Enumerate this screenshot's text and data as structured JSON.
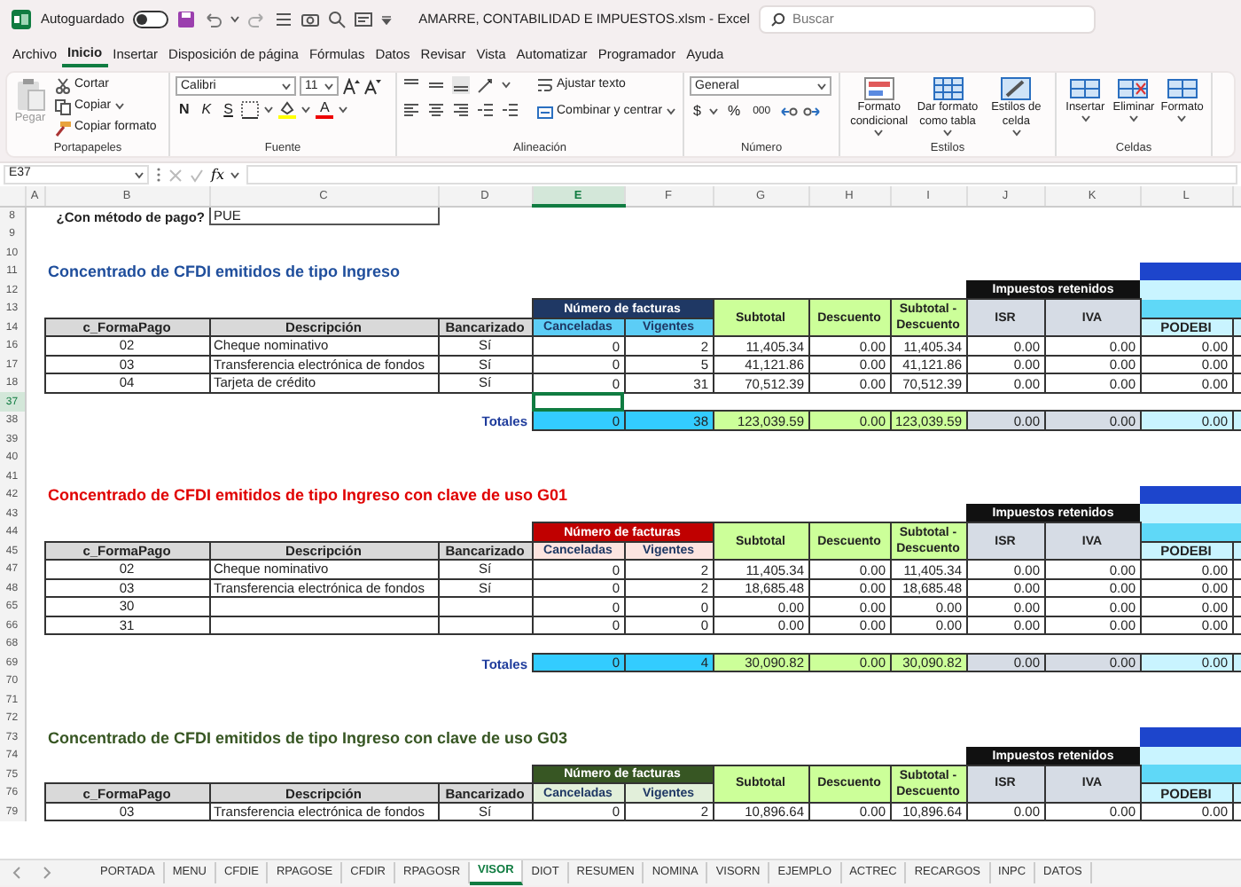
{
  "title_bar": {
    "autosave_label": "Autoguardado",
    "autosave_on": false,
    "title": "AMARRE, CONTABILIDAD E IMPUESTOS.xlsm  -  Excel",
    "search_placeholder": "Buscar"
  },
  "menu_tabs": [
    {
      "label": "Archivo",
      "selected": false
    },
    {
      "label": "Inicio",
      "selected": true
    },
    {
      "label": "Insertar",
      "selected": false
    },
    {
      "label": "Disposición de página",
      "selected": false
    },
    {
      "label": "Fórmulas",
      "selected": false
    },
    {
      "label": "Datos",
      "selected": false
    },
    {
      "label": "Revisar",
      "selected": false
    },
    {
      "label": "Vista",
      "selected": false
    },
    {
      "label": "Automatizar",
      "selected": false
    },
    {
      "label": "Programador",
      "selected": false
    },
    {
      "label": "Ayuda",
      "selected": false
    }
  ],
  "ribbon": {
    "groups": [
      {
        "label": "Portapapeles",
        "items": [
          {
            "label": "Pegar",
            "disabled": true
          },
          {
            "label": "Cortar",
            "disabled": false
          },
          {
            "label": "Copiar",
            "disabled": false
          },
          {
            "label": "Copiar formato",
            "disabled": false
          }
        ]
      },
      {
        "label": "Fuente",
        "font": "Calibri",
        "size": "11",
        "glyphs": [
          "N",
          "K",
          "S",
          "A"
        ]
      },
      {
        "label": "Alineación",
        "items": [
          {
            "label": "Ajustar texto"
          },
          {
            "label": "Combinar y centrar"
          }
        ]
      },
      {
        "label": "Número",
        "format": "General",
        "glyphs": [
          "$",
          "%",
          "000"
        ]
      },
      {
        "label": "Estilos",
        "items": [
          {
            "label": "Formato condicional"
          },
          {
            "label": "Dar formato como tabla"
          },
          {
            "label": "Estilos de celda"
          }
        ]
      },
      {
        "label": "Celdas",
        "items": [
          {
            "label": "Insertar"
          },
          {
            "label": "Eliminar"
          },
          {
            "label": "Formato"
          }
        ]
      }
    ]
  },
  "formula_bar": {
    "name_box": "E37",
    "function_label": "fx"
  },
  "columns": [
    {
      "label": "A",
      "selected": false
    },
    {
      "label": "B",
      "selected": false
    },
    {
      "label": "C",
      "selected": false
    },
    {
      "label": "D",
      "selected": false
    },
    {
      "label": "E",
      "selected": true
    },
    {
      "label": "F",
      "selected": false
    },
    {
      "label": "G",
      "selected": false
    },
    {
      "label": "H",
      "selected": false
    },
    {
      "label": "I",
      "selected": false
    },
    {
      "label": "J",
      "selected": false
    },
    {
      "label": "K",
      "selected": false
    },
    {
      "label": "L",
      "selected": false
    }
  ],
  "rows": [
    {
      "kind": "method",
      "number": "8",
      "question": "¿Con método de pago?",
      "value": "PUE"
    },
    {
      "kind": "blank",
      "number": "9",
      "selected": false
    },
    {
      "kind": "blank",
      "number": "10",
      "selected": false
    },
    {
      "kind": "title",
      "number": "11",
      "text": "Concentrado de CFDI emitidos de tipo Ingreso",
      "color": "#1f4e9c"
    },
    {
      "kind": "retenidos",
      "number": "12",
      "label": "Impuestos retenidos"
    },
    {
      "kind": "header",
      "numbers": [
        "13",
        "14"
      ],
      "group": "Número de facturas",
      "color": "#1f3864",
      "subheaders": [
        {
          "label": "Canceladas",
          "color": "#5ccdf6"
        },
        {
          "label": "Vigentes",
          "color": "#5ccdf6"
        }
      ],
      "labels": [
        "c_FormaPago",
        "Descripción",
        "Bancarizado",
        "Subtotal",
        "Descuento",
        "Subtotal - Descuento",
        "ISR",
        "IVA",
        "PODEBI"
      ]
    },
    {
      "kind": "data",
      "number": "16",
      "cells": [
        "02",
        "Cheque nominativo",
        "Sí",
        "0",
        "2",
        "11,405.34",
        "0.00",
        "11,405.34",
        "0.00",
        "0.00",
        "0.00"
      ]
    },
    {
      "kind": "data",
      "number": "17",
      "cells": [
        "03",
        "Transferencia electrónica de fondos",
        "Sí",
        "0",
        "5",
        "41,121.86",
        "0.00",
        "41,121.86",
        "0.00",
        "0.00",
        "0.00"
      ]
    },
    {
      "kind": "data",
      "number": "18",
      "cells": [
        "04",
        "Tarjeta de crédito",
        "Sí",
        "0",
        "31",
        "70,512.39",
        "0.00",
        "70,512.39",
        "0.00",
        "0.00",
        "0.00"
      ]
    },
    {
      "kind": "blank",
      "number": "37",
      "selected": true
    },
    {
      "kind": "totals",
      "number": "38",
      "label": "Totales",
      "values": [
        "0",
        "38",
        "123,039.59",
        "0.00",
        "123,039.59",
        "0.00",
        "0.00",
        "0.00"
      ]
    },
    {
      "kind": "blank",
      "number": "39",
      "selected": false
    },
    {
      "kind": "blank",
      "number": "40",
      "selected": false
    },
    {
      "kind": "blank",
      "number": "41",
      "selected": false
    },
    {
      "kind": "title",
      "number": "42",
      "text": "Concentrado de CFDI emitidos de tipo Ingreso con clave de uso G01",
      "color": "#e00000"
    },
    {
      "kind": "retenidos",
      "number": "43",
      "label": "Impuestos retenidos"
    },
    {
      "kind": "header",
      "numbers": [
        "44",
        "45"
      ],
      "group": "Número de facturas",
      "color": "#c00000",
      "subheaders": [
        {
          "label": "Canceladas",
          "color": "#fce4e0"
        },
        {
          "label": "Vigentes",
          "color": "#fce4e0"
        }
      ],
      "labels": [
        "c_FormaPago",
        "Descripción",
        "Bancarizado",
        "Subtotal",
        "Descuento",
        "Subtotal - Descuento",
        "ISR",
        "IVA",
        "PODEBI"
      ]
    },
    {
      "kind": "data",
      "number": "47",
      "cells": [
        "02",
        "Cheque nominativo",
        "Sí",
        "0",
        "2",
        "11,405.34",
        "0.00",
        "11,405.34",
        "0.00",
        "0.00",
        "0.00"
      ]
    },
    {
      "kind": "data",
      "number": "48",
      "cells": [
        "03",
        "Transferencia electrónica de fondos",
        "Sí",
        "0",
        "2",
        "18,685.48",
        "0.00",
        "18,685.48",
        "0.00",
        "0.00",
        "0.00"
      ]
    },
    {
      "kind": "data",
      "number": "65",
      "cells": [
        "30",
        "",
        "",
        "0",
        "0",
        "0.00",
        "0.00",
        "0.00",
        "0.00",
        "0.00",
        "0.00"
      ]
    },
    {
      "kind": "data",
      "number": "66",
      "cells": [
        "31",
        "",
        "",
        "0",
        "0",
        "0.00",
        "0.00",
        "0.00",
        "0.00",
        "0.00",
        "0.00"
      ]
    },
    {
      "kind": "blank",
      "number": "68",
      "selected": false
    },
    {
      "kind": "totals",
      "number": "69",
      "label": "Totales",
      "values": [
        "0",
        "4",
        "30,090.82",
        "0.00",
        "30,090.82",
        "0.00",
        "0.00",
        "0.00"
      ]
    },
    {
      "kind": "blank",
      "number": "70",
      "selected": false
    },
    {
      "kind": "blank",
      "number": "71",
      "selected": false
    },
    {
      "kind": "blank",
      "number": "72",
      "selected": false
    },
    {
      "kind": "title",
      "number": "73",
      "text": "Concentrado de CFDI emitidos de tipo Ingreso con clave de uso G03",
      "color": "#375623"
    },
    {
      "kind": "retenidos",
      "number": "74",
      "label": "Impuestos retenidos"
    },
    {
      "kind": "header",
      "numbers": [
        "75",
        "76"
      ],
      "group": "Número de facturas",
      "color": "#375623",
      "subheaders": [
        {
          "label": "Canceladas",
          "color": "#e2efda"
        },
        {
          "label": "Vigentes",
          "color": "#e2efda"
        }
      ],
      "labels": [
        "c_FormaPago",
        "Descripción",
        "Bancarizado",
        "Subtotal",
        "Descuento",
        "Subtotal - Descuento",
        "ISR",
        "IVA",
        "PODEBI"
      ]
    },
    {
      "kind": "data",
      "number": "79",
      "cells": [
        "03",
        "Transferencia electrónica de fondos",
        "Sí",
        "0",
        "2",
        "10,896.64",
        "0.00",
        "10,896.64",
        "0.00",
        "0.00",
        "0.00"
      ]
    }
  ],
  "sheet_tabs": [
    {
      "label": "PORTADA",
      "selected": false
    },
    {
      "label": "MENU",
      "selected": false
    },
    {
      "label": "CFDIE",
      "selected": false
    },
    {
      "label": "RPAGOSE",
      "selected": false
    },
    {
      "label": "CFDIR",
      "selected": false
    },
    {
      "label": "RPAGOSR",
      "selected": false
    },
    {
      "label": "VISOR",
      "selected": true
    },
    {
      "label": "DIOT",
      "selected": false
    },
    {
      "label": "RESUMEN",
      "selected": false
    },
    {
      "label": "NOMINA",
      "selected": false
    },
    {
      "label": "VISORN",
      "selected": false
    },
    {
      "label": "EJEMPLO",
      "selected": false
    },
    {
      "label": "ACTREC",
      "selected": false
    },
    {
      "label": "RECARGOS",
      "selected": false
    },
    {
      "label": "INPC",
      "selected": false
    },
    {
      "label": "DATOS",
      "selected": false
    }
  ]
}
